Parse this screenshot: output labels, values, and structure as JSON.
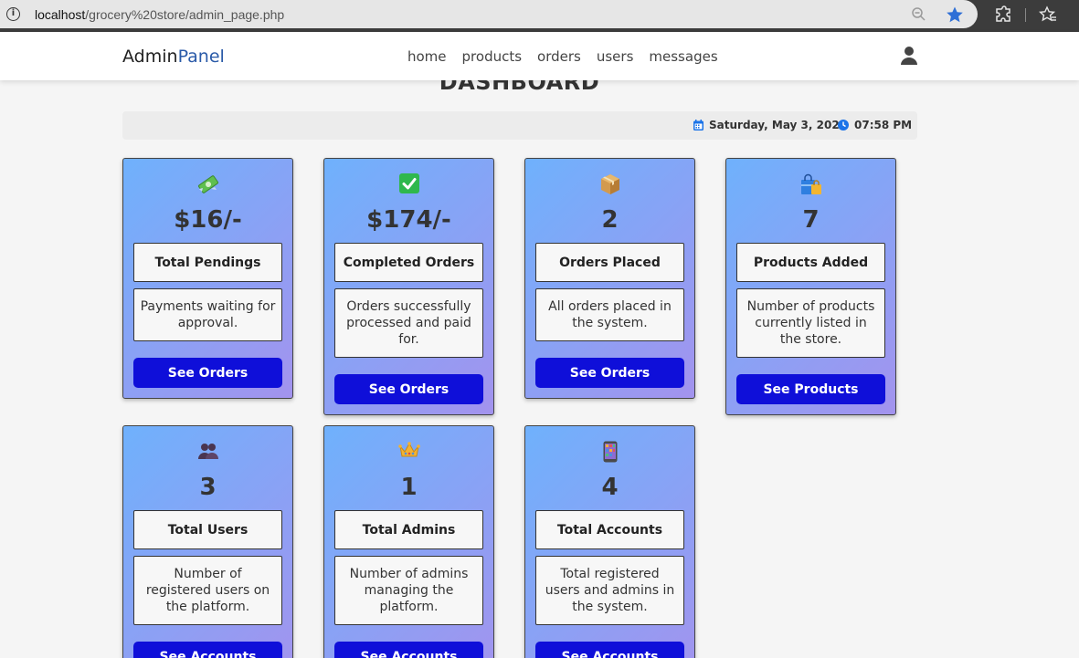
{
  "browser": {
    "url_host": "localhost",
    "url_path": "/grocery%20store/admin_page.php"
  },
  "navbar": {
    "logo_part1": "Admin",
    "logo_part2": "Panel",
    "links": [
      "home",
      "products",
      "orders",
      "users",
      "messages"
    ]
  },
  "dashboard": {
    "title": "DASHBOARD",
    "date": "Saturday, May 3, 2025",
    "time": "07:58 PM"
  },
  "cards": [
    {
      "icon": "money-icon",
      "value": "$16/-",
      "label": "Total Pendings",
      "desc": "Payments waiting for approval.",
      "button": "See Orders"
    },
    {
      "icon": "check-icon",
      "value": "$174/-",
      "label": "Completed Orders",
      "desc": "Orders successfully processed and paid for.",
      "button": "See Orders"
    },
    {
      "icon": "package-icon",
      "value": "2",
      "label": "Orders Placed",
      "desc": "All orders placed in the system.",
      "button": "See Orders"
    },
    {
      "icon": "shopping-bags-icon",
      "value": "7",
      "label": "Products Added",
      "desc": "Number of products currently listed in the store.",
      "button": "See Products"
    },
    {
      "icon": "users-icon",
      "value": "3",
      "label": "Total Users",
      "desc": "Number of registered users on the platform.",
      "button": "See Accounts"
    },
    {
      "icon": "crown-icon",
      "value": "1",
      "label": "Total Admins",
      "desc": "Number of admins managing the platform.",
      "button": "See Accounts"
    },
    {
      "icon": "phone-icon",
      "value": "4",
      "label": "Total Accounts",
      "desc": "Total registered users and admins in the system.",
      "button": "See Accounts"
    }
  ],
  "colors": {
    "card_gradient_start": "#6fb1fc",
    "card_gradient_end": "#a393ee",
    "button": "#0f0fd9",
    "logo_accent": "#2a5aa8",
    "date_icon": "#1a73e8"
  }
}
